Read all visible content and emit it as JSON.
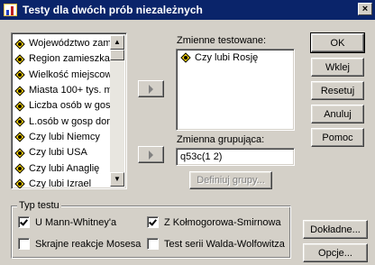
{
  "window": {
    "title": "Testy dla dwóch prób niezależnych",
    "close_glyph": "×"
  },
  "variables": [
    "Województwo zam",
    "Region zamieszkan",
    "Wielkość miejscow",
    "Miasta 100+ tys. mi",
    "Liczba osób w gosp",
    "L.osób w gosp dom",
    "Czy lubi Niemcy",
    "Czy lubi USA",
    "Czy lubi Anaglię",
    "Czy lubi Izrael"
  ],
  "test_variables": {
    "label": "Zmienne testowane:",
    "items": [
      "Czy lubi Rosję"
    ]
  },
  "grouping": {
    "label": "Zmienna grupująca:",
    "value": "q53c(1 2)",
    "define_button": "Definiuj grupy..."
  },
  "buttons": {
    "ok": "OK",
    "paste": "Wklej",
    "reset": "Resetuj",
    "cancel": "Anuluj",
    "help": "Pomoc",
    "exact": "Dokładne...",
    "options": "Opcje..."
  },
  "test_type": {
    "label": "Typ testu",
    "options": [
      {
        "label": "U Mann-Whitney'a",
        "checked": true
      },
      {
        "label": "Z Kołmogorowa-Smirnowa",
        "checked": true
      },
      {
        "label": "Skrajne reakcje Mosesa",
        "checked": false
      },
      {
        "label": "Test serii Walda-Wolfowitza",
        "checked": false
      }
    ]
  },
  "icons": {
    "variable": "scale-variable-icon",
    "scroll_up": "▲",
    "scroll_down": "▼"
  }
}
